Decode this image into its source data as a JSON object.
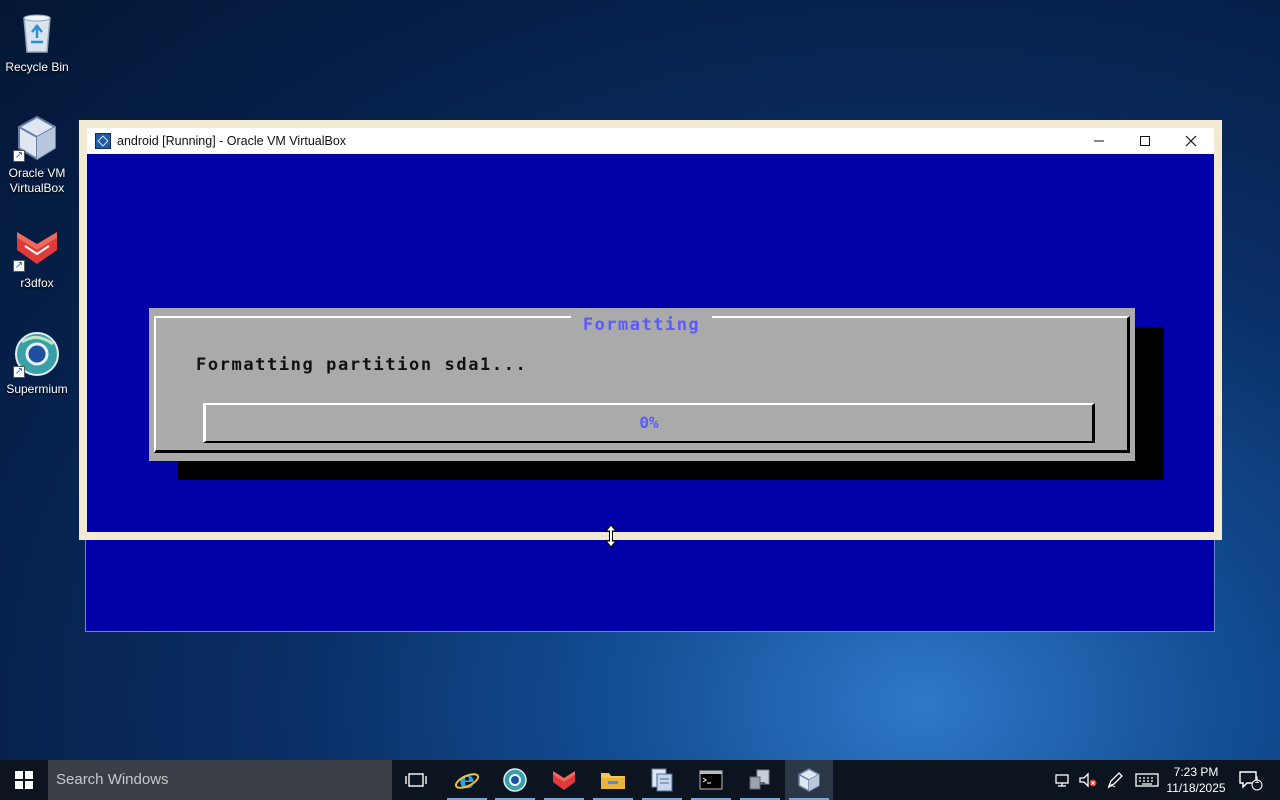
{
  "desktop": {
    "icons": [
      {
        "label": "Recycle Bin"
      },
      {
        "label": "Oracle VM\nVirtualBox"
      },
      {
        "label": "r3dfox"
      },
      {
        "label": "Supermium"
      }
    ]
  },
  "vbox_window": {
    "title": "android [Running] - Oracle VM VirtualBox",
    "controls": [
      "minimize-icon",
      "maximize-icon",
      "close-icon"
    ]
  },
  "installer_dialog": {
    "title": "Formatting",
    "message": "Formatting partition sda1...",
    "progress_percent": 0,
    "progress_label": "0%"
  },
  "taskbar": {
    "search_placeholder": "Search Windows",
    "apps": [
      "task-view",
      "internet-explorer",
      "supermium",
      "r3dfox",
      "file-explorer",
      "documents",
      "command-prompt",
      "network-tool",
      "virtualbox"
    ],
    "clock_time": "7:23 PM",
    "clock_date": "11/18/2025",
    "notification_count": "1"
  },
  "colors": {
    "vm_background": "#0000a8",
    "dialog_gray": "#aaaaaa",
    "dialog_accent": "#5a5aff"
  }
}
